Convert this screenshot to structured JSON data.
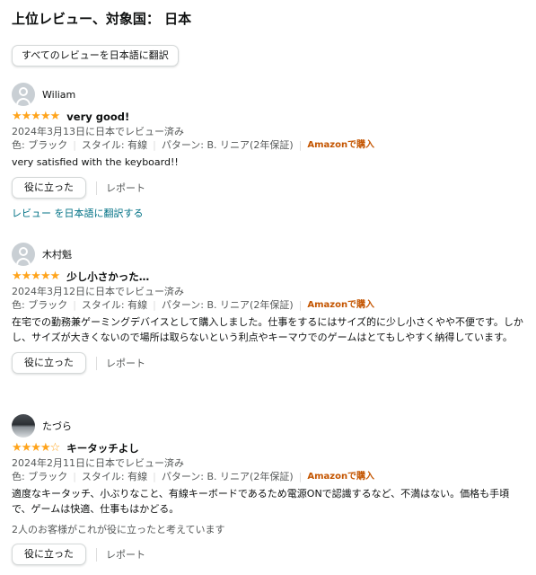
{
  "heading": "上位レビュー、対象国： 日本",
  "translate_all": "すべてのレビューを日本語に翻訳",
  "attr_labels": {
    "color": "色: ブラック",
    "style": "スタイル: 有線",
    "pattern": "パターン: B. リニア(2年保証)",
    "verified": "Amazonで購入"
  },
  "helpful_label": "役に立った",
  "report_label": "レポート",
  "reviews": [
    {
      "name": "Wiliam",
      "rating": 5,
      "stars": "★★★★★",
      "title": "very good!",
      "date": "2024年3月13日に日本でレビュー済み",
      "body": "very satisfied with the keyboard!!",
      "translate_link": "レビュー を日本語に翻訳する"
    },
    {
      "name": "木村魁",
      "rating": 5,
      "stars": "★★★★★",
      "title": "少し小さかった…",
      "date": "2024年3月12日に日本でレビュー済み",
      "body": "在宅での勤務兼ゲーミングデバイスとして購入しました。仕事をするにはサイズ的に少し小さくやや不便です。しかし、サイズが大きくないので場所は取らないという利点やキーマウでのゲームはとてもしやすく納得しています。"
    },
    {
      "name": "たづら",
      "rating": 4,
      "stars": "★★★★☆",
      "title": "キータッチよし",
      "date": "2024年2月11日に日本でレビュー済み",
      "body": "適度なキータッチ、小ぶりなこと、有線キーボードであるため電源ONで認識するなど、不満はない。価格も手頃で、ゲームは快適、仕事もはかどる。",
      "helpful_count": "2人のお客様がこれが役に立ったと考えています"
    }
  ]
}
